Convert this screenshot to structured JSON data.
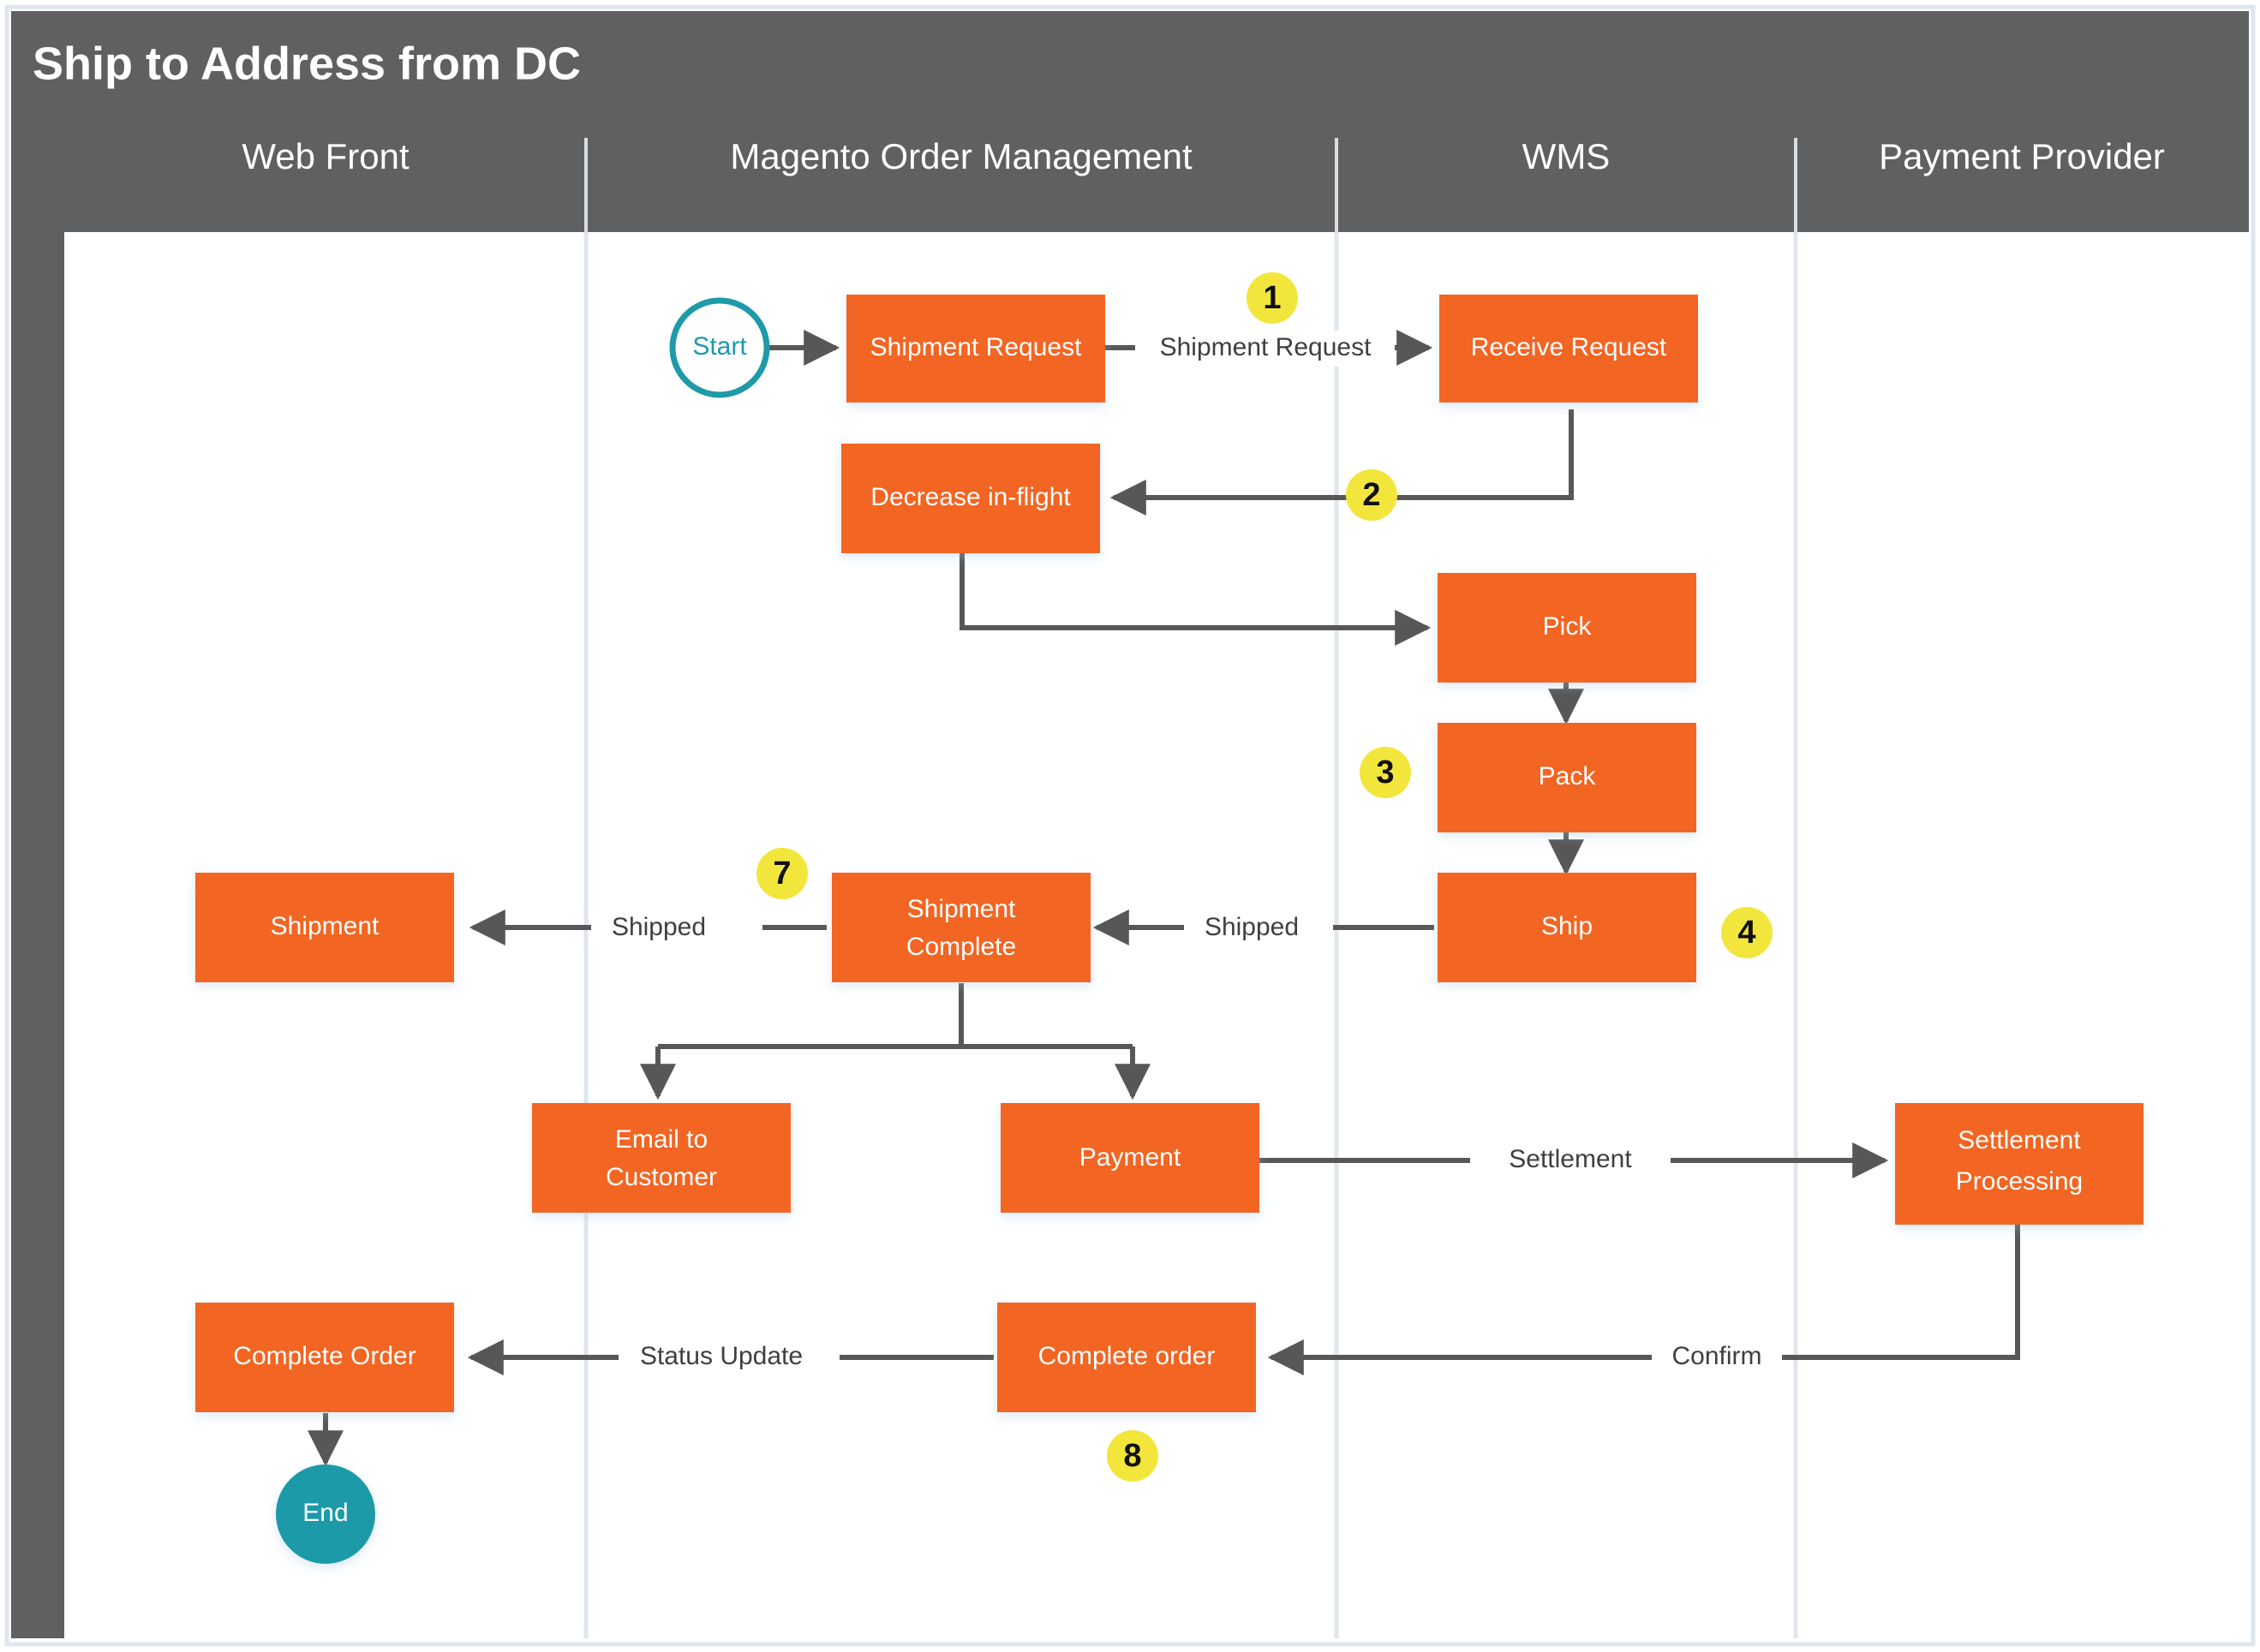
{
  "title": "Ship to Address from DC",
  "colors": {
    "header_gray": "#5f6062",
    "node_orange": "#F26522",
    "terminal_teal": "#1E9AA8",
    "badge_yellow": "#F2E63C",
    "connector_gray": "#575757",
    "lane_divider": "#dfe6ee",
    "canvas": "#ffffff"
  },
  "lanes": [
    {
      "id": "web-front",
      "label": "Web Front"
    },
    {
      "id": "magento-order-management",
      "label": "Magento Order Management"
    },
    {
      "id": "wms",
      "label": "WMS"
    },
    {
      "id": "payment-provider",
      "label": "Payment Provider"
    }
  ],
  "terminals": [
    {
      "id": "start",
      "label": "Start",
      "lane": "magento-order-management"
    },
    {
      "id": "end",
      "label": "End",
      "lane": "web-front"
    }
  ],
  "nodes": [
    {
      "id": "shipment-request",
      "label": "Shipment Request",
      "lane": "magento-order-management"
    },
    {
      "id": "receive-request",
      "label": "Receive Request",
      "lane": "wms"
    },
    {
      "id": "decrease-in-flight",
      "label": "Decrease in-flight",
      "lane": "magento-order-management"
    },
    {
      "id": "pick",
      "label": "Pick",
      "lane": "wms"
    },
    {
      "id": "pack",
      "label": "Pack",
      "lane": "wms"
    },
    {
      "id": "ship",
      "label": "Ship",
      "lane": "wms"
    },
    {
      "id": "shipment",
      "label": "Shipment",
      "lane": "web-front"
    },
    {
      "id": "shipment-complete",
      "label": "Shipment\nComplete",
      "line1": "Shipment",
      "line2": "Complete",
      "lane": "magento-order-management"
    },
    {
      "id": "email-to-customer",
      "label": "Email to\nCustomer",
      "line1": "Email to",
      "line2": "Customer",
      "lane": "magento-order-management"
    },
    {
      "id": "payment",
      "label": "Payment",
      "lane": "magento-order-management"
    },
    {
      "id": "settlement-processing",
      "label": "Settlement\nProcessing",
      "line1": "Settlement",
      "line2": "Processing",
      "lane": "payment-provider"
    },
    {
      "id": "complete-order-web",
      "label": "Complete Order",
      "lane": "web-front"
    },
    {
      "id": "complete-order-magento",
      "label": "Complete order",
      "lane": "magento-order-management"
    }
  ],
  "edge_labels": [
    {
      "id": "shipment-request-label",
      "label": "Shipment Request",
      "from": "shipment-request",
      "to": "receive-request"
    },
    {
      "id": "shipped-label-left",
      "label": "Shipped",
      "from": "shipment-complete",
      "to": "shipment"
    },
    {
      "id": "shipped-label-right",
      "label": "Shipped",
      "from": "ship",
      "to": "shipment-complete"
    },
    {
      "id": "settlement-label",
      "label": "Settlement",
      "from": "payment",
      "to": "settlement-processing"
    },
    {
      "id": "status-update-label",
      "label": "Status Update",
      "from": "complete-order-magento",
      "to": "complete-order-web"
    },
    {
      "id": "confirm-label",
      "label": "Confirm",
      "from": "settlement-processing",
      "to": "complete-order-magento"
    }
  ],
  "badges": [
    {
      "id": "badge-1",
      "label": "1"
    },
    {
      "id": "badge-2",
      "label": "2"
    },
    {
      "id": "badge-3",
      "label": "3"
    },
    {
      "id": "badge-4",
      "label": "4"
    },
    {
      "id": "badge-7",
      "label": "7"
    },
    {
      "id": "badge-8",
      "label": "8"
    }
  ]
}
